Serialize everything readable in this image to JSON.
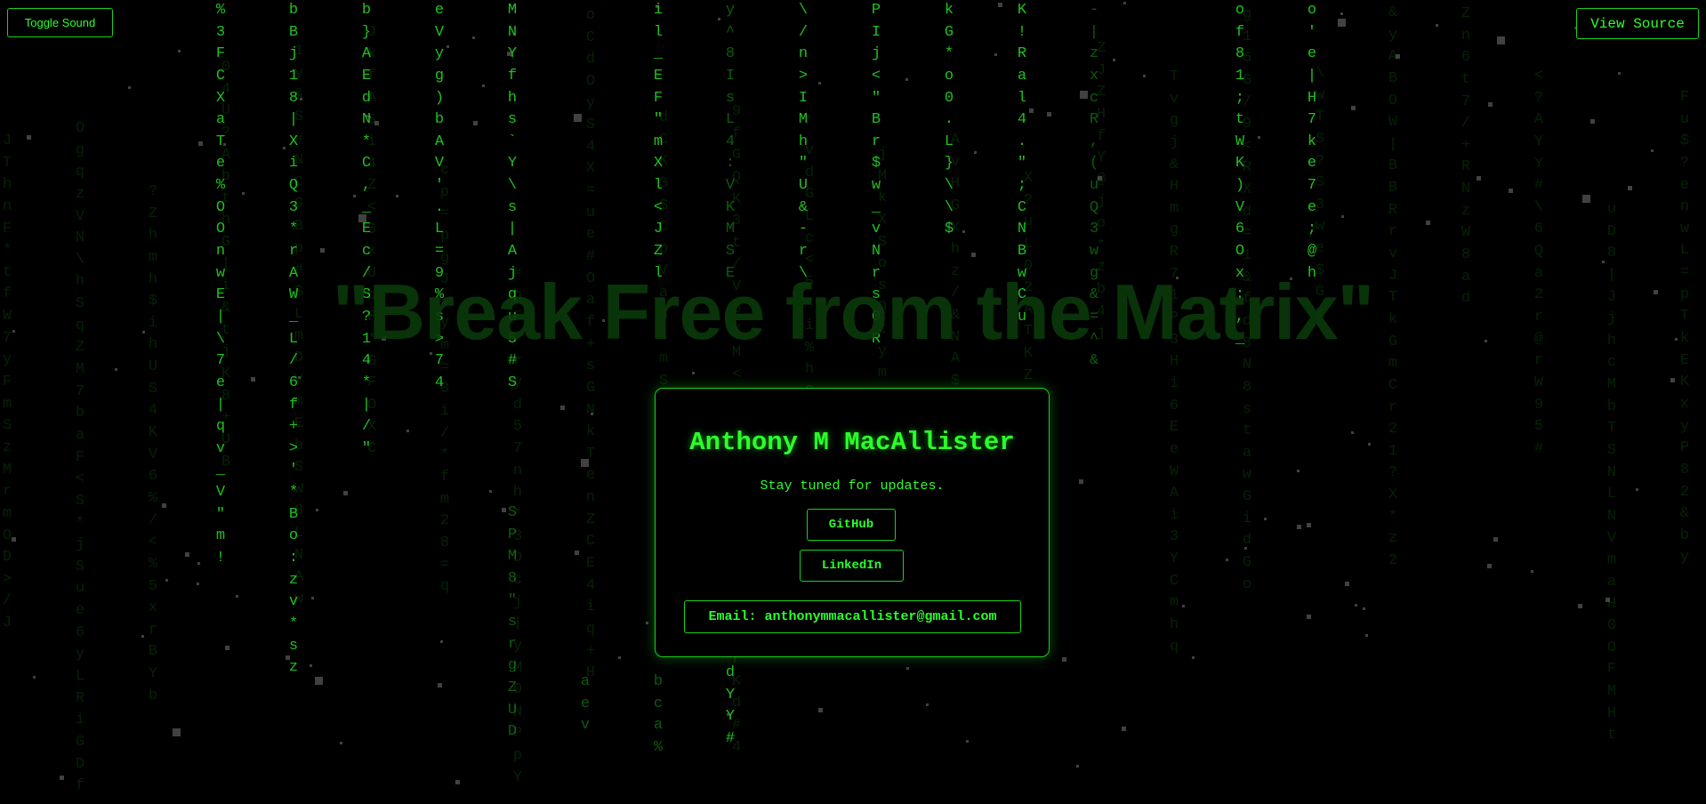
{
  "header": {
    "toggle_sound_label": "Toggle Sound",
    "view_source_label": "View Source"
  },
  "headline": "\"Break Free from the Matrix\"",
  "card": {
    "name": "Anthony M MacAllister",
    "tagline": "Stay tuned for updates.",
    "github_label": "GitHub",
    "linkedin_label": "LinkedIn",
    "email_label": "Email: anthonymmacallister@gmail.com"
  },
  "theme": {
    "accent": "#2bff2b",
    "border": "#19d219",
    "background": "#000000"
  },
  "rain_columns": [
    "%3FCXaTe%OOnwE|\\7e|qv_V\"m!",
    "bBj18|XiQ3*rAW_L/6f+>'*Bo:zv*sz",
    "b}AEdN*C,_Ec/S?14*|/\"",
    "eVyg)bAV'.L=9%s>74",
    "MNYfhs`Y\\s|Ajqu5#S",
    "il_EF\"mXl<JZl",
    "y^8IsL4:VKMSE",
    "\\/n>IMh\"U&-r\\",
    "PIj<\"Br$w_vNrs0R",
    "kG*o0.L}\\\\$",
    "K!Ral4.\";CNBwCu",
    "-|zxcR,(uQ3wg&=^&",
    "of81;tWK)V6Ox:,_",
    "o'e|H7ke7e;@h"
  ],
  "rain_tail_columns": [
    "aev",
    "bca%",
    "dYY#",
    "SPM8\"srgZUD"
  ]
}
